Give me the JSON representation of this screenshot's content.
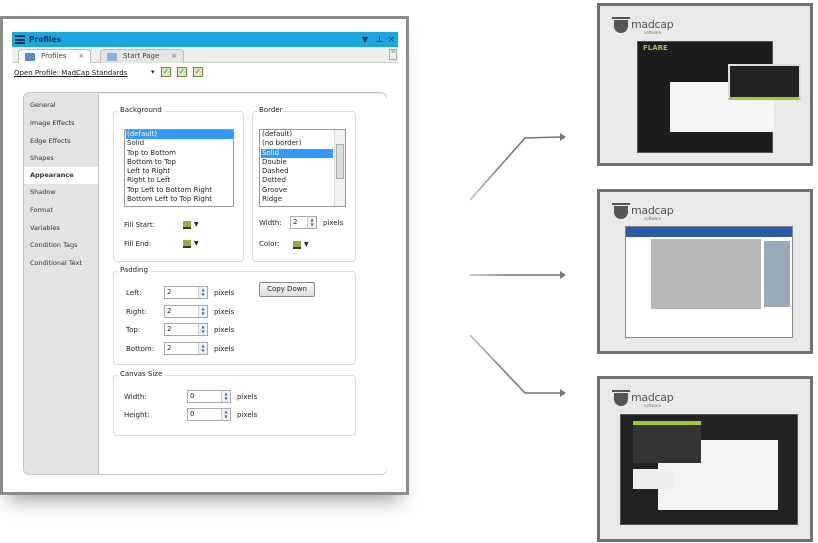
{
  "window": {
    "title": "Profiles",
    "title_icons": [
      "dropdown-icon",
      "pin-icon",
      "close-icon"
    ]
  },
  "tabs": [
    {
      "label": "Profiles",
      "close": "×",
      "active": true
    },
    {
      "label": "Start Page",
      "close": "×",
      "active": false
    }
  ],
  "toolbar": {
    "open_profile": "Open Profile: MadCap Standards",
    "dropdown": "▾",
    "icons": [
      "save-profile-icon",
      "edit-profile-icon",
      "delete-profile-icon"
    ]
  },
  "sidebar": {
    "items": [
      "General",
      "Image Effects",
      "Edge Effects",
      "Shapes",
      "Appearance",
      "Shadow",
      "Format",
      "Variables",
      "Condition Tags",
      "Conditional Text"
    ],
    "selected": "Appearance"
  },
  "background": {
    "legend": "Background",
    "options": [
      "(default)",
      "Solid",
      "Top to Bottom",
      "Bottom to Top",
      "Left to Right",
      "Right to Left",
      "Top Left to Bottom Right",
      "Bottom Left to Top Right"
    ],
    "selected": "(default)",
    "fill_start_label": "Fill Start:",
    "fill_end_label": "Fill End:"
  },
  "border": {
    "legend": "Border",
    "options": [
      "(default)",
      "(no border)",
      "Solid",
      "Double",
      "Dashed",
      "Dotted",
      "Groove",
      "Ridge"
    ],
    "selected": "Solid",
    "width_label": "Width:",
    "width_value": "2",
    "width_unit": "pixels",
    "color_label": "Color:"
  },
  "padding": {
    "legend": "Padding",
    "rows": [
      {
        "label": "Left:",
        "value": "2",
        "unit": "pixels"
      },
      {
        "label": "Right:",
        "value": "2",
        "unit": "pixels"
      },
      {
        "label": "Top:",
        "value": "2",
        "unit": "pixels"
      },
      {
        "label": "Bottom:",
        "value": "2",
        "unit": "pixels"
      }
    ],
    "copy_down": "Copy Down"
  },
  "canvas": {
    "legend": "Canvas Size",
    "rows": [
      {
        "label": "Width:",
        "value": "0",
        "unit": "pixels"
      },
      {
        "label": "Height:",
        "value": "0",
        "unit": "pixels"
      }
    ]
  },
  "thumbnails": [
    {
      "logo": "madcap",
      "logo_sub": "software",
      "app": "FLARE"
    },
    {
      "logo": "madcap",
      "logo_sub": "software"
    },
    {
      "logo": "madcap",
      "logo_sub": "software"
    }
  ],
  "colors": {
    "titlebar": "#1ba6de",
    "selection": "#3399ff",
    "accent_green": "#9acd32"
  }
}
